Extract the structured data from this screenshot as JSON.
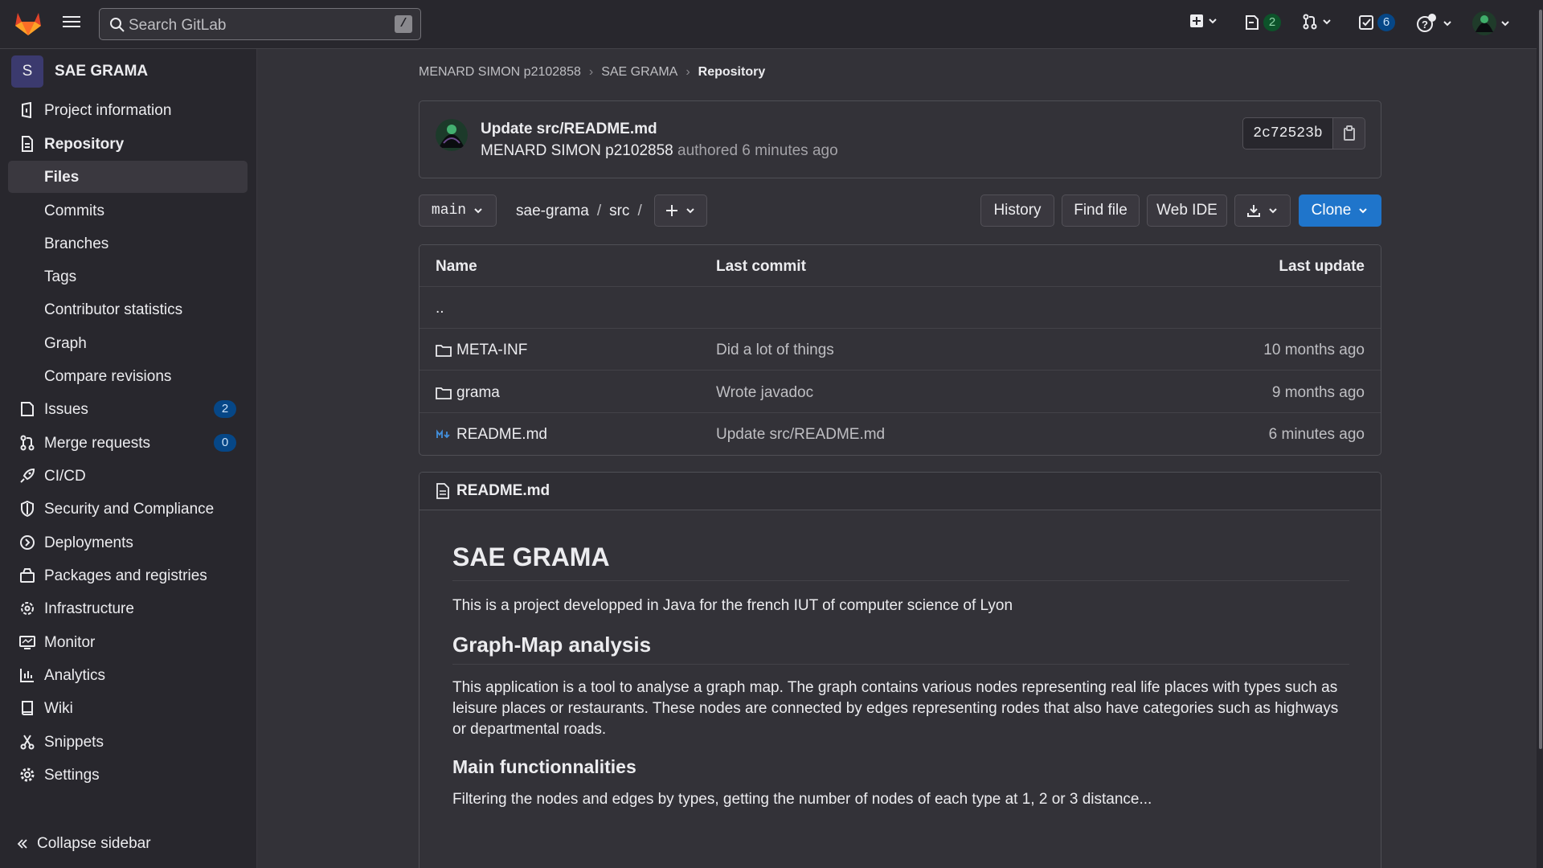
{
  "topbar": {
    "search_placeholder": "Search GitLab",
    "search_shortcut": "/",
    "issues_count": "2",
    "todos_count": "6"
  },
  "sidebar": {
    "project_avatar_letter": "S",
    "project_name": "SAE GRAMA",
    "items": [
      {
        "label": "Project information",
        "icon": "info-icon"
      },
      {
        "label": "Repository",
        "icon": "repository-icon"
      },
      {
        "label": "Files"
      },
      {
        "label": "Commits"
      },
      {
        "label": "Branches"
      },
      {
        "label": "Tags"
      },
      {
        "label": "Contributor statistics"
      },
      {
        "label": "Graph"
      },
      {
        "label": "Compare revisions"
      },
      {
        "label": "Issues",
        "icon": "issues-icon",
        "count": "2"
      },
      {
        "label": "Merge requests",
        "icon": "merge-request-icon",
        "count": "0"
      },
      {
        "label": "CI/CD",
        "icon": "rocket-icon"
      },
      {
        "label": "Security and Compliance",
        "icon": "shield-icon"
      },
      {
        "label": "Deployments",
        "icon": "deployments-icon"
      },
      {
        "label": "Packages and registries",
        "icon": "package-icon"
      },
      {
        "label": "Infrastructure",
        "icon": "cloud-gear-icon"
      },
      {
        "label": "Monitor",
        "icon": "monitor-icon"
      },
      {
        "label": "Analytics",
        "icon": "chart-icon"
      },
      {
        "label": "Wiki",
        "icon": "book-icon"
      },
      {
        "label": "Snippets",
        "icon": "scissors-icon"
      },
      {
        "label": "Settings",
        "icon": "gear-icon"
      }
    ],
    "collapse_label": "Collapse sidebar"
  },
  "breadcrumb": {
    "items": [
      "MENARD SIMON p2102858",
      "SAE GRAMA",
      "Repository"
    ]
  },
  "commit": {
    "title": "Update src/README.md",
    "author": "MENARD SIMON p2102858",
    "meta": "authored 6 minutes ago",
    "sha": "2c72523b"
  },
  "toolbar": {
    "branch": "main",
    "path": [
      "sae-grama",
      "src"
    ],
    "history": "History",
    "find_file": "Find file",
    "web_ide": "Web IDE",
    "clone": "Clone"
  },
  "tree": {
    "headers": {
      "name": "Name",
      "last_commit": "Last commit",
      "last_update": "Last update"
    },
    "parent": "..",
    "rows": [
      {
        "name": "META-INF",
        "type": "folder",
        "commit": "Did a lot of things",
        "updated": "10 months ago"
      },
      {
        "name": "grama",
        "type": "folder",
        "commit": "Wrote javadoc",
        "updated": "9 months ago"
      },
      {
        "name": "README.md",
        "type": "markdown",
        "commit": "Update src/README.md",
        "updated": "6 minutes ago"
      }
    ]
  },
  "readme": {
    "filename": "README.md",
    "h1": "SAE GRAMA",
    "p1": "This is a project developped in Java for the french IUT of computer science of Lyon",
    "h2": "Graph-Map analysis",
    "p2": "This application is a tool to analyse a graph map. The graph contains various nodes representing real life places with types such as leisure places or restaurants. These nodes are connected by edges representing rodes that also have categories such as highways or departmental roads.",
    "h3": "Main functionnalities",
    "p3": "Filtering the nodes and edges by types, getting the number of nodes of each type at 1, 2 or 3 distance..."
  },
  "colors": {
    "accent": "#1f75cb",
    "background": "#333238",
    "sidebar": "#28272d"
  }
}
